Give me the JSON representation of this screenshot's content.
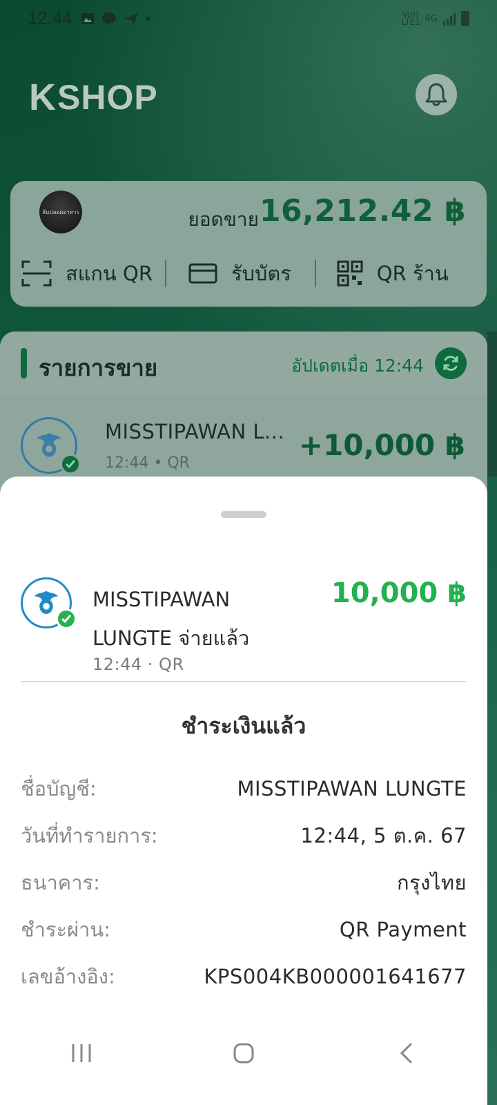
{
  "status_bar": {
    "time": "12:44",
    "network": "4G",
    "volte": "Vo)) LTE1"
  },
  "header": {
    "logo_k": "K",
    "logo_text": "SHOP"
  },
  "sales_card": {
    "avatar_text": "ส้มปลอดอาหาร",
    "label": "ยอดขาย",
    "amount": "16,212.42 ฿",
    "actions": [
      {
        "label": "สแกน QR",
        "icon": "scan-qr-icon"
      },
      {
        "label": "รับบัตร",
        "icon": "card-icon"
      },
      {
        "label": "QR ร้าน",
        "icon": "qr-code-icon"
      }
    ]
  },
  "sales_list": {
    "title": "รายการขาย",
    "updated": "อัปเดตเมื่อ 12:44",
    "rows": [
      {
        "name": "MISSTIPAWAN L...",
        "meta": "12:44 • QR",
        "amount": "+10,000 ฿"
      }
    ]
  },
  "sheet": {
    "name": "MISSTIPAWAN LUNGTE จ่ายแล้ว",
    "meta": "12:44 · QR",
    "amount": "10,000 ฿",
    "status": "ชำระเงินแล้ว",
    "details": [
      {
        "key": "ชื่อบัญชี:",
        "value": "MISSTIPAWAN LUNGTE"
      },
      {
        "key": "วันที่ทำรายการ:",
        "value": "12:44, 5 ต.ค. 67"
      },
      {
        "key": "ธนาคาร:",
        "value": "กรุงไทย"
      },
      {
        "key": "ชำระผ่าน:",
        "value": "QR Payment"
      },
      {
        "key": "เลขอ้างอิง:",
        "value": "KPS004KB000001641677"
      }
    ]
  },
  "colors": {
    "brand_green": "#0f6a3e",
    "amount_green": "#23b14f",
    "krungthai_blue": "#1f8bc6"
  }
}
